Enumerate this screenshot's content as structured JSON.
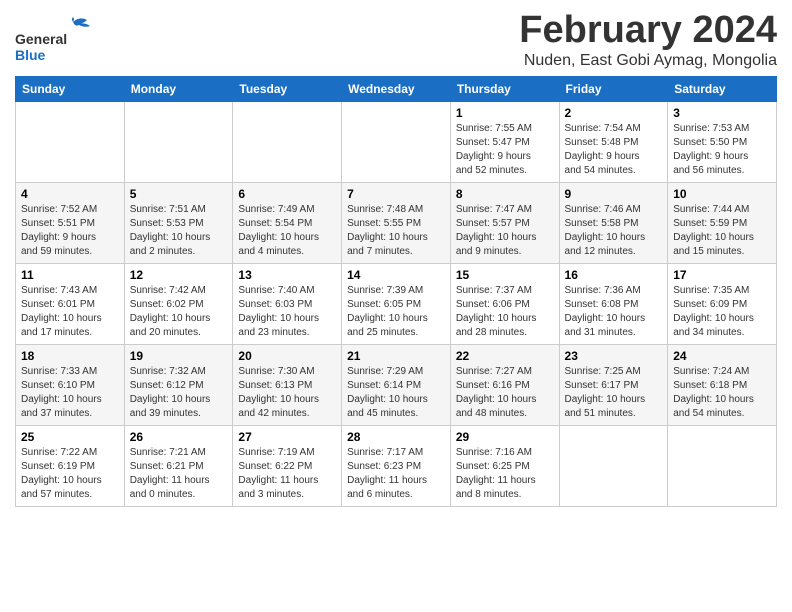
{
  "header": {
    "logo_general": "General",
    "logo_blue": "Blue",
    "month_title": "February 2024",
    "location": "Nuden, East Gobi Aymag, Mongolia"
  },
  "days_of_week": [
    "Sunday",
    "Monday",
    "Tuesday",
    "Wednesday",
    "Thursday",
    "Friday",
    "Saturday"
  ],
  "weeks": [
    [
      {
        "day": "",
        "info": ""
      },
      {
        "day": "",
        "info": ""
      },
      {
        "day": "",
        "info": ""
      },
      {
        "day": "",
        "info": ""
      },
      {
        "day": "1",
        "info": "Sunrise: 7:55 AM\nSunset: 5:47 PM\nDaylight: 9 hours\nand 52 minutes."
      },
      {
        "day": "2",
        "info": "Sunrise: 7:54 AM\nSunset: 5:48 PM\nDaylight: 9 hours\nand 54 minutes."
      },
      {
        "day": "3",
        "info": "Sunrise: 7:53 AM\nSunset: 5:50 PM\nDaylight: 9 hours\nand 56 minutes."
      }
    ],
    [
      {
        "day": "4",
        "info": "Sunrise: 7:52 AM\nSunset: 5:51 PM\nDaylight: 9 hours\nand 59 minutes."
      },
      {
        "day": "5",
        "info": "Sunrise: 7:51 AM\nSunset: 5:53 PM\nDaylight: 10 hours\nand 2 minutes."
      },
      {
        "day": "6",
        "info": "Sunrise: 7:49 AM\nSunset: 5:54 PM\nDaylight: 10 hours\nand 4 minutes."
      },
      {
        "day": "7",
        "info": "Sunrise: 7:48 AM\nSunset: 5:55 PM\nDaylight: 10 hours\nand 7 minutes."
      },
      {
        "day": "8",
        "info": "Sunrise: 7:47 AM\nSunset: 5:57 PM\nDaylight: 10 hours\nand 9 minutes."
      },
      {
        "day": "9",
        "info": "Sunrise: 7:46 AM\nSunset: 5:58 PM\nDaylight: 10 hours\nand 12 minutes."
      },
      {
        "day": "10",
        "info": "Sunrise: 7:44 AM\nSunset: 5:59 PM\nDaylight: 10 hours\nand 15 minutes."
      }
    ],
    [
      {
        "day": "11",
        "info": "Sunrise: 7:43 AM\nSunset: 6:01 PM\nDaylight: 10 hours\nand 17 minutes."
      },
      {
        "day": "12",
        "info": "Sunrise: 7:42 AM\nSunset: 6:02 PM\nDaylight: 10 hours\nand 20 minutes."
      },
      {
        "day": "13",
        "info": "Sunrise: 7:40 AM\nSunset: 6:03 PM\nDaylight: 10 hours\nand 23 minutes."
      },
      {
        "day": "14",
        "info": "Sunrise: 7:39 AM\nSunset: 6:05 PM\nDaylight: 10 hours\nand 25 minutes."
      },
      {
        "day": "15",
        "info": "Sunrise: 7:37 AM\nSunset: 6:06 PM\nDaylight: 10 hours\nand 28 minutes."
      },
      {
        "day": "16",
        "info": "Sunrise: 7:36 AM\nSunset: 6:08 PM\nDaylight: 10 hours\nand 31 minutes."
      },
      {
        "day": "17",
        "info": "Sunrise: 7:35 AM\nSunset: 6:09 PM\nDaylight: 10 hours\nand 34 minutes."
      }
    ],
    [
      {
        "day": "18",
        "info": "Sunrise: 7:33 AM\nSunset: 6:10 PM\nDaylight: 10 hours\nand 37 minutes."
      },
      {
        "day": "19",
        "info": "Sunrise: 7:32 AM\nSunset: 6:12 PM\nDaylight: 10 hours\nand 39 minutes."
      },
      {
        "day": "20",
        "info": "Sunrise: 7:30 AM\nSunset: 6:13 PM\nDaylight: 10 hours\nand 42 minutes."
      },
      {
        "day": "21",
        "info": "Sunrise: 7:29 AM\nSunset: 6:14 PM\nDaylight: 10 hours\nand 45 minutes."
      },
      {
        "day": "22",
        "info": "Sunrise: 7:27 AM\nSunset: 6:16 PM\nDaylight: 10 hours\nand 48 minutes."
      },
      {
        "day": "23",
        "info": "Sunrise: 7:25 AM\nSunset: 6:17 PM\nDaylight: 10 hours\nand 51 minutes."
      },
      {
        "day": "24",
        "info": "Sunrise: 7:24 AM\nSunset: 6:18 PM\nDaylight: 10 hours\nand 54 minutes."
      }
    ],
    [
      {
        "day": "25",
        "info": "Sunrise: 7:22 AM\nSunset: 6:19 PM\nDaylight: 10 hours\nand 57 minutes."
      },
      {
        "day": "26",
        "info": "Sunrise: 7:21 AM\nSunset: 6:21 PM\nDaylight: 11 hours\nand 0 minutes."
      },
      {
        "day": "27",
        "info": "Sunrise: 7:19 AM\nSunset: 6:22 PM\nDaylight: 11 hours\nand 3 minutes."
      },
      {
        "day": "28",
        "info": "Sunrise: 7:17 AM\nSunset: 6:23 PM\nDaylight: 11 hours\nand 6 minutes."
      },
      {
        "day": "29",
        "info": "Sunrise: 7:16 AM\nSunset: 6:25 PM\nDaylight: 11 hours\nand 8 minutes."
      },
      {
        "day": "",
        "info": ""
      },
      {
        "day": "",
        "info": ""
      }
    ]
  ]
}
